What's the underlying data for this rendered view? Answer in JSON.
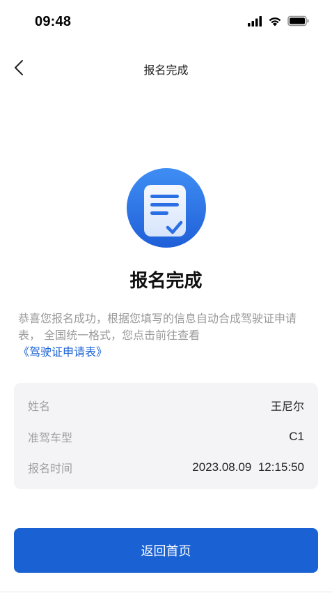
{
  "status_bar": {
    "time": "09:48",
    "icons": [
      "signal-icon",
      "wifi-icon",
      "battery-icon"
    ]
  },
  "nav": {
    "title": "报名完成",
    "back_icon": "chevron-left-icon"
  },
  "result": {
    "icon": "document-check-icon",
    "title": "报名完成",
    "description": "恭喜您报名成功，根据您填写的信息自动合成驾驶证申请表， 全国统一格式，您点击前往查看",
    "link_text": "《驾驶证申请表》"
  },
  "info": {
    "rows": [
      {
        "label": "姓名",
        "value": "王尼尔"
      },
      {
        "label": "准驾车型",
        "value": "C1"
      },
      {
        "label": "报名时间",
        "value": "2023.08.09  12:15:50"
      }
    ]
  },
  "actions": {
    "back_home_label": "返回首页"
  },
  "colors": {
    "accent": "#1a62d4",
    "card_bg": "#f4f4f6",
    "muted_text": "#9a9a9a"
  }
}
